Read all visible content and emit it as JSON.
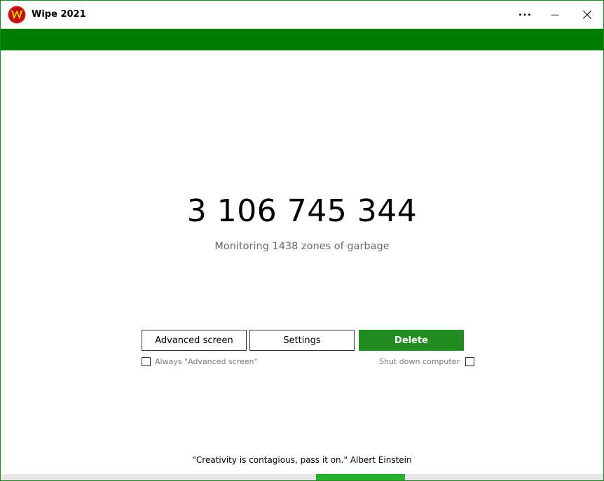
{
  "window": {
    "title": "Wipe 2021",
    "controls": {
      "more": "•••"
    }
  },
  "main": {
    "counter": "3 106 745 344",
    "subtitle": "Monitoring 1438 zones of garbage"
  },
  "buttons": {
    "advanced": "Advanced screen",
    "settings": "Settings",
    "delete": "Delete"
  },
  "options": {
    "always_advanced": {
      "label": "Always \"Advanced screen\"",
      "checked": false
    },
    "shutdown": {
      "label": "Shut down computer",
      "checked": false
    }
  },
  "footer": {
    "quote": "\"Creativity is contagious, pass it on.\" Albert Einstein"
  },
  "colors": {
    "banner": "#007c00",
    "delete_button": "#228b22",
    "progress": "#22b02e",
    "logo_red": "#d11a1a",
    "logo_yellow": "#ffc400"
  }
}
